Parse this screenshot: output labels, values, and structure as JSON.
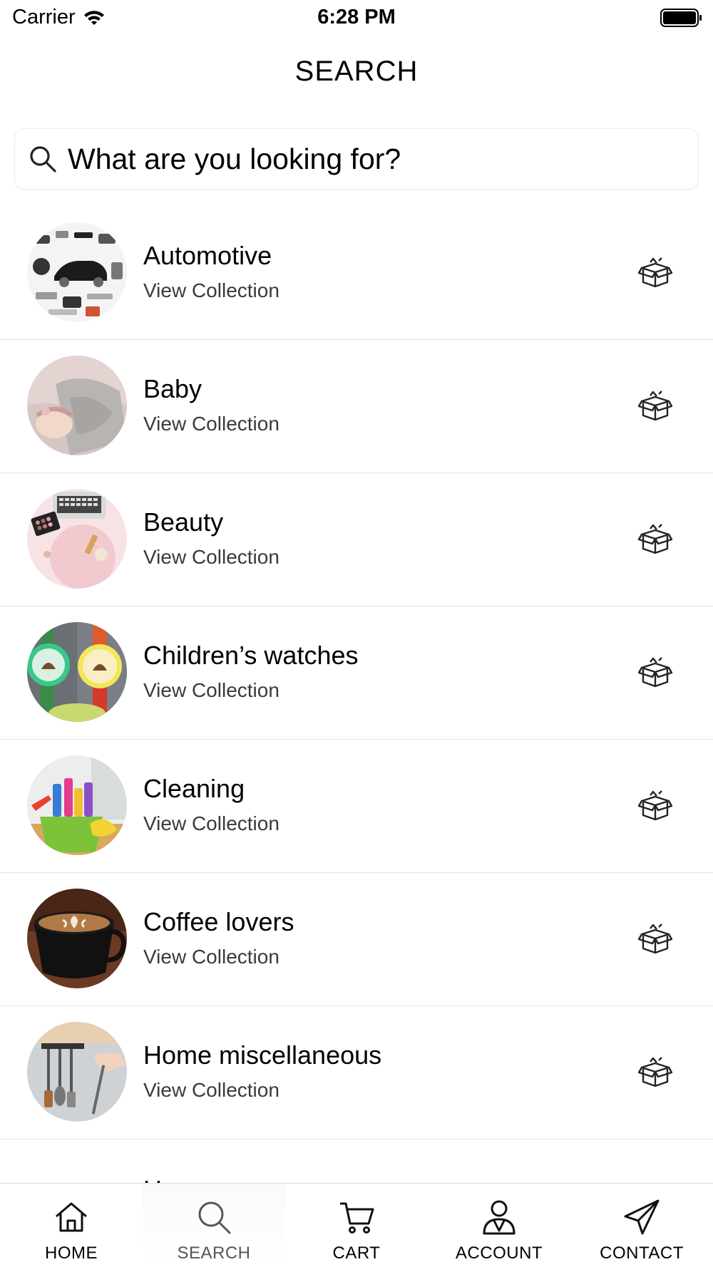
{
  "status_bar": {
    "carrier": "Carrier",
    "time": "6:28 PM",
    "wifi_icon": "wifi-icon",
    "battery_icon": "battery-icon"
  },
  "header": {
    "title": "SEARCH"
  },
  "search": {
    "placeholder": "What are you looking for?",
    "icon": "search-icon"
  },
  "collections": [
    {
      "name": "Automotive",
      "action": "View Collection",
      "icon": "gift-box-icon"
    },
    {
      "name": "Baby",
      "action": "View Collection",
      "icon": "gift-box-icon"
    },
    {
      "name": "Beauty",
      "action": "View Collection",
      "icon": "gift-box-icon"
    },
    {
      "name": "Children’s watches",
      "action": "View Collection",
      "icon": "gift-box-icon"
    },
    {
      "name": "Cleaning",
      "action": "View Collection",
      "icon": "gift-box-icon"
    },
    {
      "name": "Coffee lovers",
      "action": "View Collection",
      "icon": "gift-box-icon"
    },
    {
      "name": "Home miscellaneous",
      "action": "View Collection",
      "icon": "gift-box-icon"
    },
    {
      "name": "Home page",
      "action": "",
      "icon": ""
    }
  ],
  "tab_bar": {
    "tabs": [
      {
        "label": "HOME",
        "icon": "home-icon",
        "active": false
      },
      {
        "label": "SEARCH",
        "icon": "search-icon",
        "active": true
      },
      {
        "label": "CART",
        "icon": "cart-icon",
        "active": false
      },
      {
        "label": "ACCOUNT",
        "icon": "account-icon",
        "active": false
      },
      {
        "label": "CONTACT",
        "icon": "paper-plane-icon",
        "active": false
      }
    ]
  }
}
